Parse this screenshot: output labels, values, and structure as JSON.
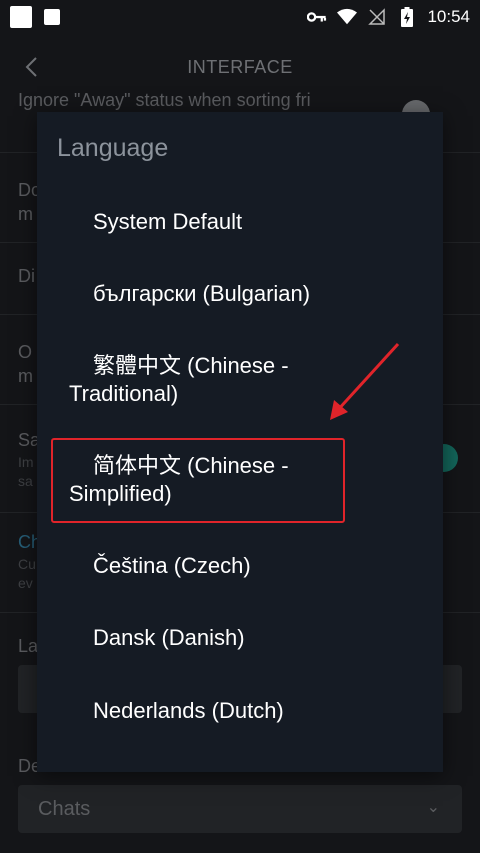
{
  "statusbar": {
    "time": "10:54",
    "icons": [
      "notification-square-icon",
      "notification-square-icon",
      "key-icon",
      "wifi-icon",
      "no-sim-icon",
      "battery-charging-icon"
    ]
  },
  "appbar": {
    "title": "INTERFACE",
    "back_icon": "chevron-left-icon"
  },
  "settings": {
    "row1": "Ignore \"Away\" status when sorting fri",
    "row2a": "Do",
    "row2b": "m",
    "row3": "Di",
    "row4a": "O",
    "row4b": "m",
    "row5": "Sa",
    "row5sub1": "Im",
    "row5sub2": "sa",
    "row6": "Ch",
    "row6sub1": "Cu",
    "row6sub2": "ev",
    "row7": "La",
    "row8": "De",
    "default_field": "Chats"
  },
  "dialog": {
    "title": "Language",
    "options": [
      {
        "line1": "System Default",
        "line2": ""
      },
      {
        "line1": "български (Bulgarian)",
        "line2": ""
      },
      {
        "line1": "繁體中文 (Chinese -",
        "line2": "Traditional)"
      },
      {
        "line1": "简体中文 (Chinese -",
        "line2": "Simplified)"
      },
      {
        "line1": "Čeština (Czech)",
        "line2": ""
      },
      {
        "line1": "Dansk (Danish)",
        "line2": ""
      },
      {
        "line1": "Nederlands (Dutch)",
        "line2": ""
      }
    ]
  },
  "colors": {
    "accent": "#1e9b8a",
    "highlight": "#e0242a",
    "dialog_bg": "#151b24"
  }
}
